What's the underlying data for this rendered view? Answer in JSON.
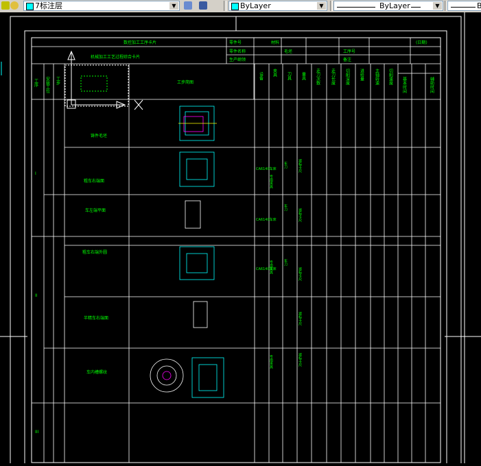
{
  "toolbar": {
    "layer_combo_text": "7标注层",
    "color_combo_text": "ByLayer",
    "linetype_combo_text": "ByLayer",
    "lineweight_combo_text": "B"
  },
  "drawing": {
    "card_title": "数控加工工序卡片",
    "sheet_title_left": "机械加工工艺过程综合卡片",
    "header_labels": [
      "零件号",
      "材料",
      "零件名称",
      "毛坯",
      "生产纲领",
      "工序号",
      "备注",
      "(日期)"
    ],
    "column_labels": [
      "工序",
      "安装工位",
      "工步",
      "工步简图",
      "设备",
      "夹具",
      "刀具",
      "量具",
      "走刀次数",
      "走刀长度",
      "切削深度",
      "进给量",
      "主轴转速",
      "切削速度",
      "基本时间",
      "辅助时间"
    ],
    "row_roman": [
      "I",
      "II",
      "III"
    ],
    "step_names": [
      "铸件毛坯",
      "粗车右端面",
      "车左端平面",
      "粗车右端外圆",
      "半精车右端面",
      "车内槽螺纹"
    ],
    "fixture": "专用夹具",
    "tool": "车刀",
    "gauge": "游标卡尺",
    "machine": "CA6140车床"
  }
}
